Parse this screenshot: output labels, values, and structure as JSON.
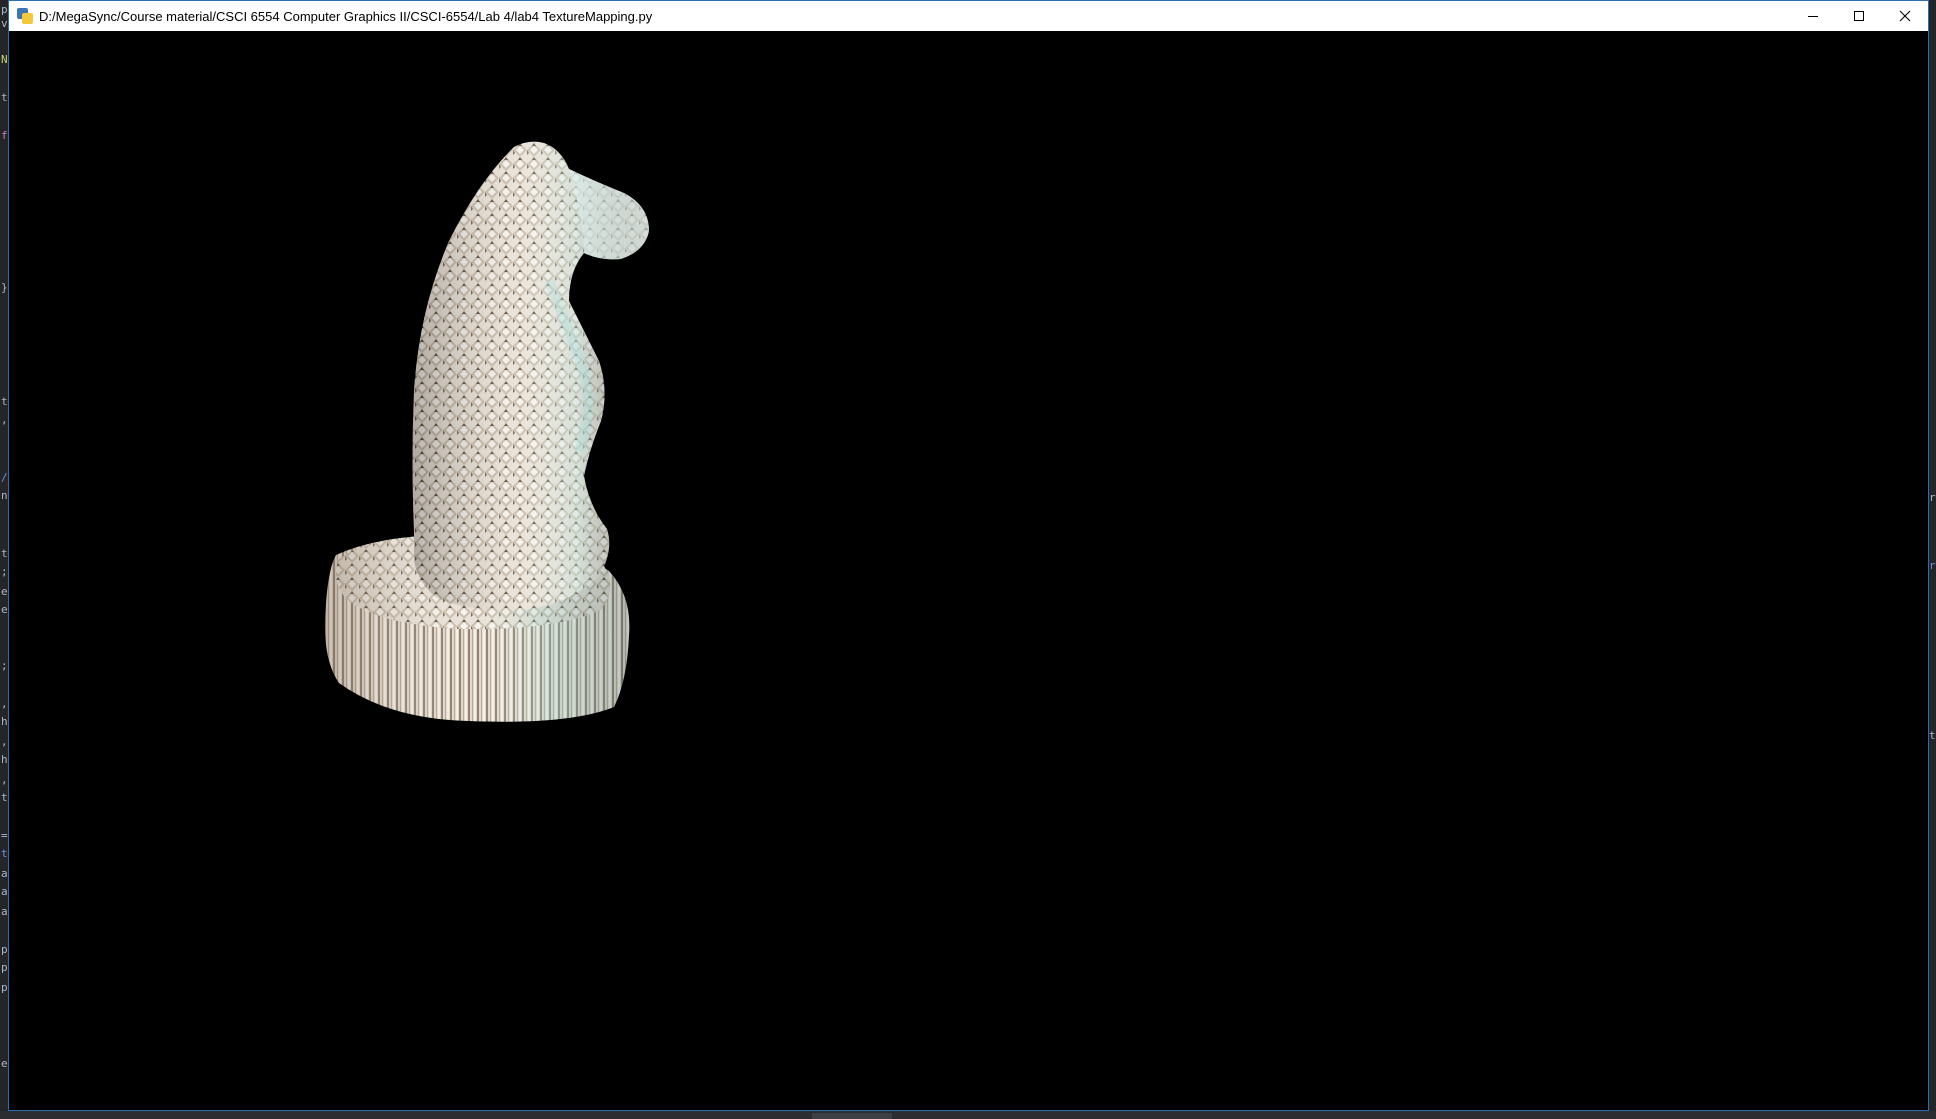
{
  "window": {
    "title": "D:/MegaSync/Course material/CSCI 6554 Computer Graphics II/CSCI-6554/Lab 4/lab4 TextureMapping.py",
    "minimize_icon": "minimize-icon",
    "maximize_icon": "maximize-icon",
    "close_icon": "close-icon"
  },
  "viewport": {
    "background": "#000000",
    "model_texture_colors": [
      "#e6dccf",
      "#bfe0dc",
      "#8a7a6a",
      "#f4efe8"
    ]
  },
  "background_editor": {
    "left_chars": [
      "p",
      "v",
      "N",
      "t",
      "f",
      "}",
      "t",
      ",",
      "/",
      "n",
      "t",
      ";",
      "e",
      "e",
      ";",
      ",",
      "h",
      ",",
      "h",
      ",",
      "t",
      "=",
      "t",
      "a",
      "a",
      "a",
      "p",
      "p",
      "p",
      "e"
    ],
    "right_chars": [
      "r",
      "r",
      "t"
    ]
  }
}
